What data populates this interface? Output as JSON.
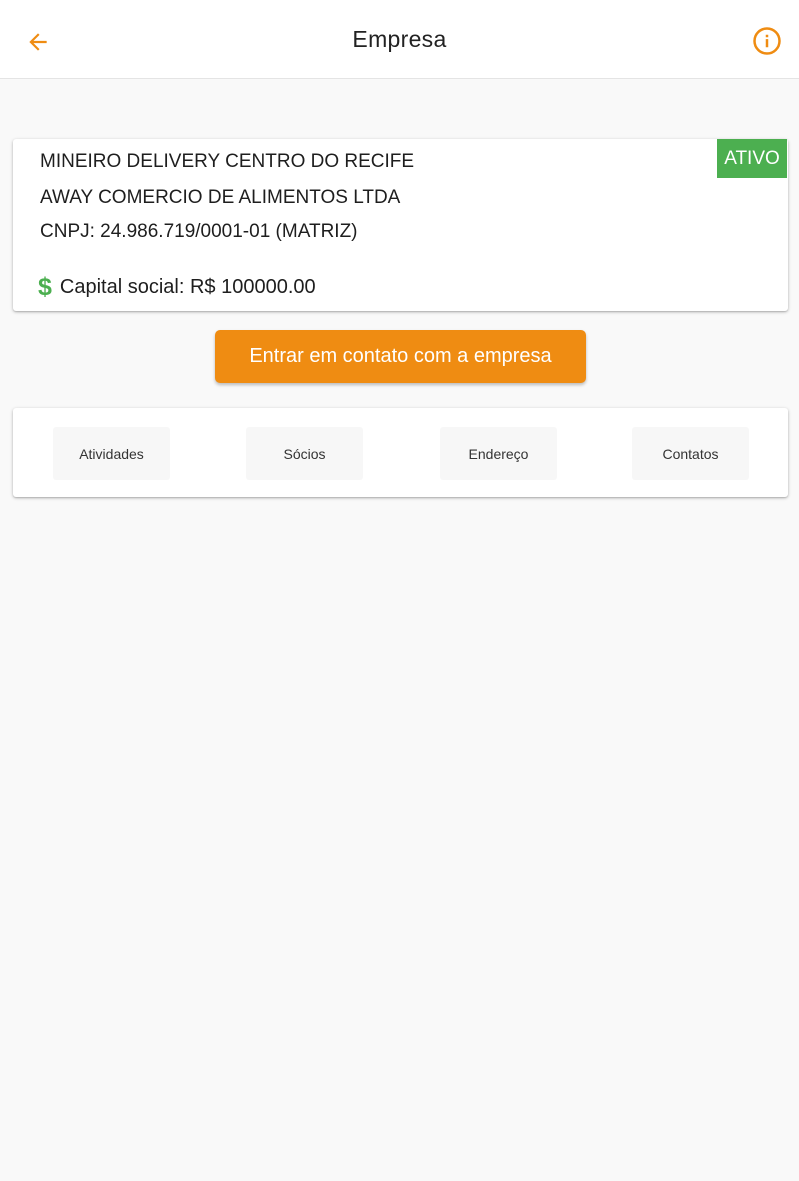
{
  "appbar": {
    "title": "Empresa",
    "back_icon": "arrow-left-icon",
    "info_icon": "info-circle-icon"
  },
  "company": {
    "trade_name": "MINEIRO DELIVERY CENTRO DO RECIFE",
    "legal_name": "AWAY COMERCIO DE ALIMENTOS LTDA",
    "cnpj": "CNPJ: 24.986.719/0001-01 (MATRIZ)",
    "capital_icon": "dollar-icon",
    "capital_symbol": "$",
    "capital": "Capital social: R$ 100000.00",
    "status": "ATIVO"
  },
  "contact_button": {
    "label": "Entrar em contato com a empresa"
  },
  "tabs": [
    {
      "label": "Atividades"
    },
    {
      "label": "Sócios"
    },
    {
      "label": "Endereço"
    },
    {
      "label": "Contatos"
    }
  ],
  "colors": {
    "accent": "#ef8c12",
    "status_green": "#4caf50",
    "background": "#f9f9f9"
  }
}
